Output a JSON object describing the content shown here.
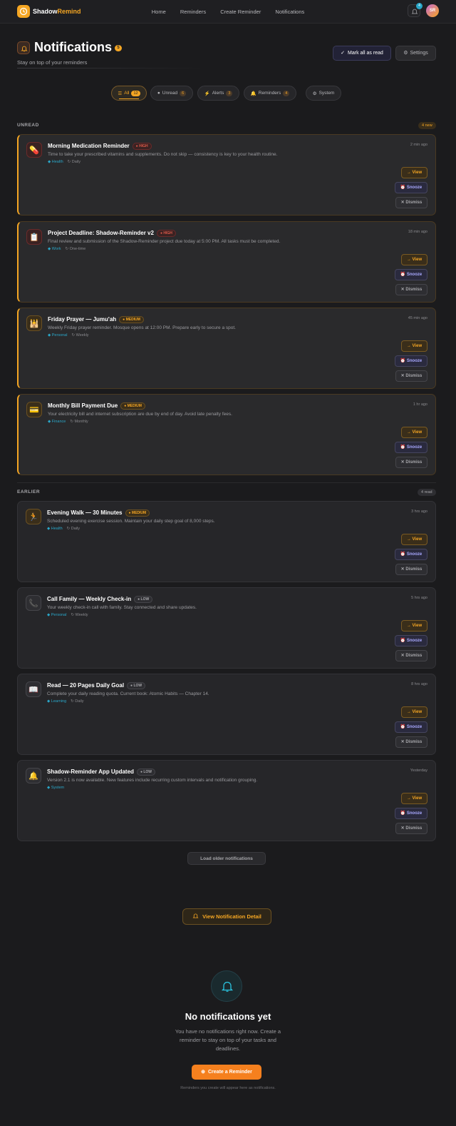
{
  "nav": {
    "brand_part1": "Shadow",
    "brand_part2": "Remind",
    "links": [
      "Home",
      "Reminders",
      "Create Reminder",
      "Notifications"
    ],
    "bell_count": "4",
    "avatar_initials": "SR"
  },
  "header": {
    "title": "Notifications",
    "badge": "5",
    "subtitle": "Stay on top of your reminders",
    "mark_all_label": "Mark all as read",
    "settings_label": "Settings"
  },
  "tabs": [
    {
      "label": "All",
      "icon": "☰",
      "count": "12",
      "active": true
    },
    {
      "label": "Unread",
      "icon": "●",
      "count": "6"
    },
    {
      "label": "Alerts",
      "icon": "⚡",
      "count": "3"
    },
    {
      "label": "Reminders",
      "icon": "🔔",
      "count": "4"
    },
    {
      "label": "System",
      "icon": "⚙"
    }
  ],
  "sections": {
    "unread_label": "UNREAD",
    "unread_badge": "4 new",
    "earlier_label": "EARLIER",
    "earlier_badge": "4 read"
  },
  "actions": {
    "view": "→ View",
    "snooze": "⏰ Snooze",
    "dismiss": "✕ Dismiss"
  },
  "notifications": [
    {
      "title": "Morning Medication Reminder",
      "priority": "● HIGH",
      "time": "2 min ago",
      "desc": "Time to take your prescribed vitamins and supplements. Do not skip — consistency is key to your health routine.",
      "category": "◆ Health",
      "repeat": "↻ Daily",
      "icon": "💊"
    },
    {
      "title": "Project Deadline: Shadow-Reminder v2",
      "priority": "● HIGH",
      "time": "18 min ago",
      "desc": "Final review and submission of the Shadow-Reminder project due today at 5:00 PM. All tasks must be completed.",
      "category": "◆ Work",
      "repeat": "↻ One-time",
      "icon": "📋"
    },
    {
      "title": "Friday Prayer — Jumu'ah",
      "priority": "● MEDIUM",
      "time": "45 min ago",
      "desc": "Weekly Friday prayer reminder. Mosque opens at 12:00 PM. Prepare early to secure a spot.",
      "category": "◆ Personal",
      "repeat": "↻ Weekly",
      "icon": "🕌"
    },
    {
      "title": "Monthly Bill Payment Due",
      "priority": "● MEDIUM",
      "time": "1 hr ago",
      "desc": "Your electricity bill and internet subscription are due by end of day. Avoid late penalty fees.",
      "category": "◆ Finance",
      "repeat": "↻ Monthly",
      "icon": "💳"
    },
    {
      "title": "Evening Walk — 30 Minutes",
      "priority": "● MEDIUM",
      "time": "3 hrs ago",
      "desc": "Scheduled evening exercise session. Maintain your daily step goal of 8,000 steps.",
      "category": "◆ Health",
      "repeat": "↻ Daily",
      "icon": "🏃"
    },
    {
      "title": "Call Family — Weekly Check-in",
      "priority": "● LOW",
      "time": "5 hrs ago",
      "desc": "Your weekly check-in call with family. Stay connected and share updates.",
      "category": "◆ Personal",
      "repeat": "↻ Weekly",
      "icon": "📞"
    },
    {
      "title": "Read — 20 Pages Daily Goal",
      "priority": "● LOW",
      "time": "8 hrs ago",
      "desc": "Complete your daily reading quota. Current book: Atomic Habits — Chapter 14.",
      "category": "◆ Learning",
      "repeat": "↻ Daily",
      "icon": "📖"
    },
    {
      "title": "Shadow-Reminder App Updated",
      "priority": "● LOW",
      "time": "Yesterday",
      "desc": "Version 2.1 is now available. New features include recurring custom intervals and notification grouping.",
      "category": "◆ System",
      "repeat": "",
      "icon": "🔔"
    }
  ],
  "load_older": "Load older notifications",
  "view_detail": "View Notification Detail",
  "empty": {
    "title": "No notifications yet",
    "text": "You have no notifications right now. Create a reminder to stay on top of your tasks and deadlines.",
    "button": "Create a Reminder",
    "footnote": "Reminders you create will appear here as notifications."
  },
  "colors": {
    "accent": "#f5a623",
    "cyan": "#2aa7c9",
    "high": "#e05a4a",
    "bg": "#1b1b1d"
  }
}
